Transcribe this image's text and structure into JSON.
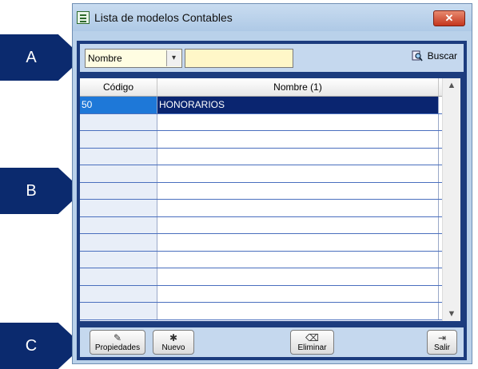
{
  "callouts": {
    "a": "A",
    "b": "B",
    "c": "C"
  },
  "window": {
    "title": "Lista de modelos Contables",
    "close_glyph": "✕"
  },
  "filter": {
    "combo_value": "Nombre",
    "search_value": "",
    "search_button": "Buscar"
  },
  "grid": {
    "headers": [
      "Código",
      "Nombre (1)"
    ],
    "rows": [
      {
        "codigo": "50",
        "nombre": "HONORARIOS"
      }
    ]
  },
  "buttons": {
    "propiedades": "Propiedades",
    "nuevo": "Nuevo",
    "eliminar": "Eliminar",
    "salir": "Salir"
  },
  "icons": {
    "app": "list-document-icon",
    "search": "magnifier-icon",
    "propiedades": "edit-properties-icon",
    "nuevo": "new-document-icon",
    "eliminar": "eraser-icon",
    "salir": "exit-door-icon"
  },
  "colors": {
    "frame": "#1c3c7e",
    "callout": "#0b2a6e",
    "selected_row": "#0a2570",
    "selected_code": "#1e78d8"
  }
}
